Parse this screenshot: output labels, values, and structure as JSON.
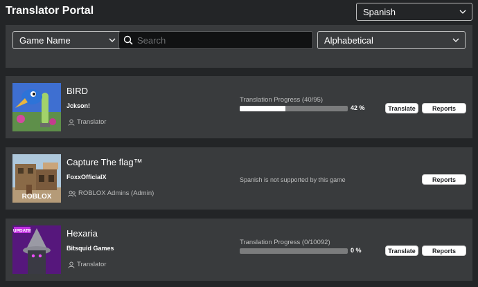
{
  "header": {
    "title": "Translator Portal",
    "language": "Spanish"
  },
  "filters": {
    "field": "Game Name",
    "search_placeholder": "Search",
    "sort": "Alphabetical"
  },
  "games": [
    {
      "name": "BIRD",
      "creator": "Jckson!",
      "role": "Translator",
      "role_icon": "user-icon",
      "supported": true,
      "progress_label": "Translation Progress (40/95)",
      "progress_fraction": 0.42,
      "percent": "42 %",
      "translate_label": "Translate",
      "reports_label": "Reports"
    },
    {
      "name": "Capture The flag™",
      "creator": "FoxxOfficialX",
      "role": "ROBLOX Admins (Admin)",
      "role_icon": "group-icon",
      "supported": false,
      "thumb_overlay": "ROBLOX",
      "unsupported_message": "Spanish is not supported by this game",
      "reports_label": "Reports"
    },
    {
      "name": "Hexaria",
      "creator": "Bitsquid Games",
      "role": "Translator",
      "role_icon": "user-icon",
      "supported": true,
      "thumb_overlay": "UPDATE",
      "progress_label": "Translation Progress (0/10092)",
      "progress_fraction": 0,
      "percent": "0 %",
      "translate_label": "Translate",
      "reports_label": "Reports"
    }
  ],
  "colors": {
    "background": "#232527",
    "panel": "#393b3d",
    "text_secondary": "#bdbebe",
    "button": "#ffffff"
  }
}
